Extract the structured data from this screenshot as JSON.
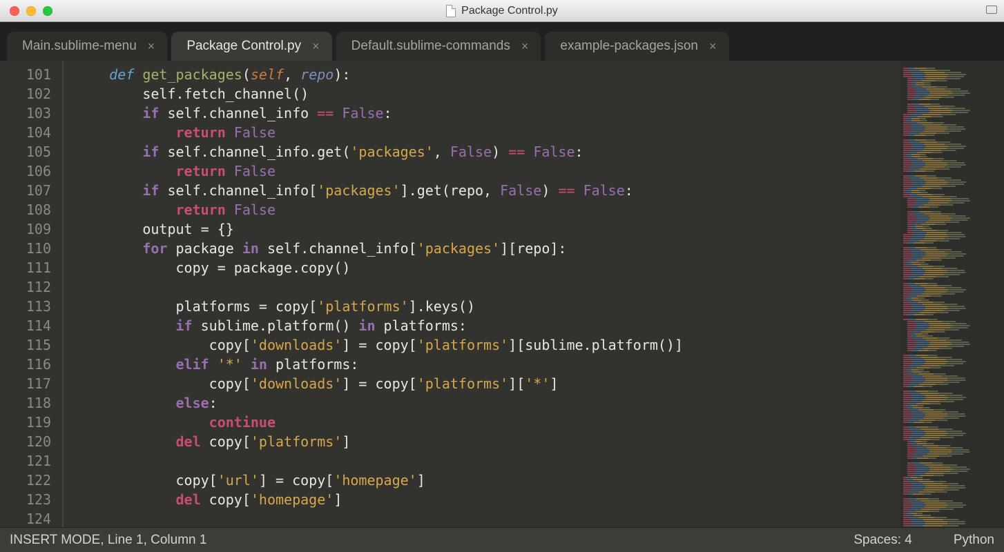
{
  "window": {
    "title": "Package Control.py"
  },
  "traffic_colors": {
    "close": "#ff5f57",
    "minimize": "#febc2e",
    "zoom": "#28c840"
  },
  "tabs": [
    {
      "label": "Main.sublime-menu",
      "active": false
    },
    {
      "label": "Package Control.py",
      "active": true
    },
    {
      "label": "Default.sublime-commands",
      "active": false
    },
    {
      "label": "example-packages.json",
      "active": false
    }
  ],
  "gutter": {
    "start": 101,
    "end": 124
  },
  "code_lines": [
    [
      [
        "    "
      ],
      [
        "kw1",
        "def "
      ],
      [
        "fn",
        "get_packages"
      ],
      [
        "punc",
        "("
      ],
      [
        "self",
        "self"
      ],
      [
        "punc",
        ", "
      ],
      [
        "arg",
        "repo"
      ],
      [
        "punc",
        "):"
      ]
    ],
    [
      [
        "        "
      ],
      [
        "id",
        "self.fetch_channel()"
      ]
    ],
    [
      [
        "        "
      ],
      [
        "kw2",
        "if "
      ],
      [
        "id",
        "self.channel_info "
      ],
      [
        "op",
        "== "
      ],
      [
        "const",
        "False"
      ],
      [
        "punc",
        ":"
      ]
    ],
    [
      [
        "            "
      ],
      [
        "ret",
        "return "
      ],
      [
        "const",
        "False"
      ]
    ],
    [
      [
        "        "
      ],
      [
        "kw2",
        "if "
      ],
      [
        "id",
        "self.channel_info.get("
      ],
      [
        "str",
        "'packages'"
      ],
      [
        "punc",
        ", "
      ],
      [
        "const",
        "False"
      ],
      [
        "punc",
        ") "
      ],
      [
        "op",
        "== "
      ],
      [
        "const",
        "False"
      ],
      [
        "punc",
        ":"
      ]
    ],
    [
      [
        "            "
      ],
      [
        "ret",
        "return "
      ],
      [
        "const",
        "False"
      ]
    ],
    [
      [
        "        "
      ],
      [
        "kw2",
        "if "
      ],
      [
        "id",
        "self.channel_info["
      ],
      [
        "str",
        "'packages'"
      ],
      [
        "id",
        "].get(repo, "
      ],
      [
        "const",
        "False"
      ],
      [
        "punc",
        ") "
      ],
      [
        "op",
        "== "
      ],
      [
        "const",
        "False"
      ],
      [
        "punc",
        ":"
      ]
    ],
    [
      [
        "            "
      ],
      [
        "ret",
        "return "
      ],
      [
        "const",
        "False"
      ]
    ],
    [
      [
        "        "
      ],
      [
        "id",
        "output = {}"
      ]
    ],
    [
      [
        "        "
      ],
      [
        "kw2",
        "for "
      ],
      [
        "id",
        "package "
      ],
      [
        "kw2",
        "in "
      ],
      [
        "id",
        "self.channel_info["
      ],
      [
        "str",
        "'packages'"
      ],
      [
        "id",
        "][repo]:"
      ]
    ],
    [
      [
        "            "
      ],
      [
        "id",
        "copy = package.copy()"
      ]
    ],
    [
      [
        ""
      ]
    ],
    [
      [
        "            "
      ],
      [
        "id",
        "platforms = copy["
      ],
      [
        "str",
        "'platforms'"
      ],
      [
        "id",
        "].keys()"
      ]
    ],
    [
      [
        "            "
      ],
      [
        "kw2",
        "if "
      ],
      [
        "id",
        "sublime.platform() "
      ],
      [
        "kw2",
        "in "
      ],
      [
        "id",
        "platforms:"
      ]
    ],
    [
      [
        "                "
      ],
      [
        "id",
        "copy["
      ],
      [
        "str",
        "'downloads'"
      ],
      [
        "id",
        "] = copy["
      ],
      [
        "str",
        "'platforms'"
      ],
      [
        "id",
        "][sublime.platform()]"
      ]
    ],
    [
      [
        "            "
      ],
      [
        "kw2",
        "elif "
      ],
      [
        "str",
        "'*'"
      ],
      [
        "id",
        " "
      ],
      [
        "kw2",
        "in "
      ],
      [
        "id",
        "platforms:"
      ]
    ],
    [
      [
        "                "
      ],
      [
        "id",
        "copy["
      ],
      [
        "str",
        "'downloads'"
      ],
      [
        "id",
        "] = copy["
      ],
      [
        "str",
        "'platforms'"
      ],
      [
        "id",
        "]["
      ],
      [
        "str",
        "'*'"
      ],
      [
        "id",
        "]"
      ]
    ],
    [
      [
        "            "
      ],
      [
        "kw2",
        "else"
      ],
      [
        "punc",
        ":"
      ]
    ],
    [
      [
        "                "
      ],
      [
        "ret",
        "continue"
      ]
    ],
    [
      [
        "            "
      ],
      [
        "ret",
        "del "
      ],
      [
        "id",
        "copy["
      ],
      [
        "str",
        "'platforms'"
      ],
      [
        "id",
        "]"
      ]
    ],
    [
      [
        ""
      ]
    ],
    [
      [
        "            "
      ],
      [
        "id",
        "copy["
      ],
      [
        "str",
        "'url'"
      ],
      [
        "id",
        "] = copy["
      ],
      [
        "str",
        "'homepage'"
      ],
      [
        "id",
        "]"
      ]
    ],
    [
      [
        "            "
      ],
      [
        "ret",
        "del "
      ],
      [
        "id",
        "copy["
      ],
      [
        "str",
        "'homepage'"
      ],
      [
        "id",
        "]"
      ]
    ],
    [
      [
        ""
      ]
    ]
  ],
  "status": {
    "left": "INSERT MODE, Line 1, Column 1",
    "spaces": "Spaces: 4",
    "syntax": "Python"
  }
}
